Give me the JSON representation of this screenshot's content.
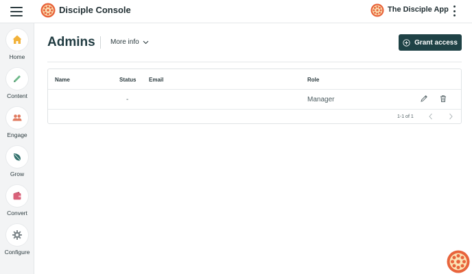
{
  "topbar": {
    "brand_title": "Disciple Console",
    "app_name": "The Disciple App"
  },
  "sidebar": {
    "items": [
      {
        "label": "Home",
        "icon": "home-icon"
      },
      {
        "label": "Content",
        "icon": "pencil-icon"
      },
      {
        "label": "Engage",
        "icon": "people-icon"
      },
      {
        "label": "Grow",
        "icon": "leaf-icon"
      },
      {
        "label": "Convert",
        "icon": "wallet-icon"
      },
      {
        "label": "Configure",
        "icon": "gear-icon"
      }
    ]
  },
  "page": {
    "title": "Admins",
    "more_info": "More info",
    "grant_access": "Grant access"
  },
  "table": {
    "headers": [
      "Name",
      "Status",
      "Email",
      "Role"
    ],
    "rows": [
      {
        "name": "",
        "status": "-",
        "email": "",
        "role": "Manager"
      }
    ],
    "pagination": "1-1 of 1"
  },
  "colors": {
    "accent": "#1f4246",
    "logo_orange": "#e8643c",
    "logo_yellow": "#f6c65b",
    "sidebar_bg": "#f3f4f5"
  }
}
